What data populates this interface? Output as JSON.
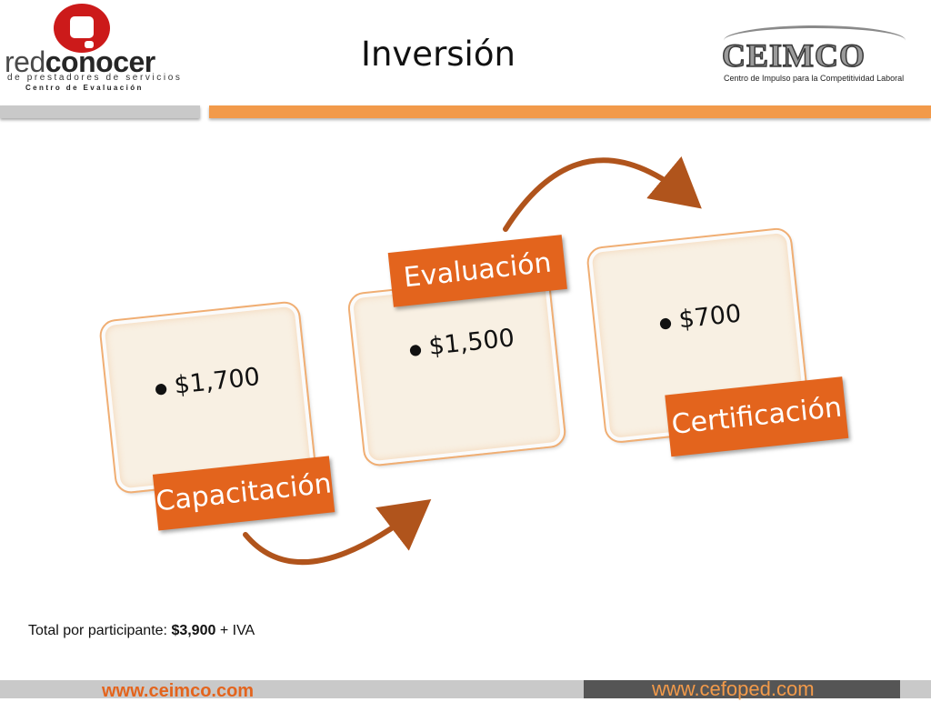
{
  "header": {
    "title": "Inversión",
    "left_logo": {
      "brand_part1": "red",
      "brand_part2": "conocer",
      "subtitle": "de prestadores de servicios",
      "subtitle2": "Centro de Evaluación",
      "circle_color": "#cc1a1a"
    },
    "right_logo": {
      "wordmark": "CEIMCO",
      "tagline": "Centro de Impulso para la Competitividad Laboral"
    }
  },
  "colors": {
    "accent_orange": "#e3641d",
    "light_orange": "#f29a4a",
    "card_fill": "#f8f0e3",
    "arrow": "#b0541c"
  },
  "diagram": {
    "steps": [
      {
        "label": "Capacitación",
        "price": "$1,700"
      },
      {
        "label": "Evaluación",
        "price": "$1,500"
      },
      {
        "label": "Certificación",
        "price": "$700"
      }
    ]
  },
  "summary": {
    "label": "Total por participante:",
    "amount": "$3,900",
    "suffix": "+ IVA"
  },
  "footer": {
    "left_url": "www.ceimco.com",
    "right_url": "www.cefoped.com"
  }
}
